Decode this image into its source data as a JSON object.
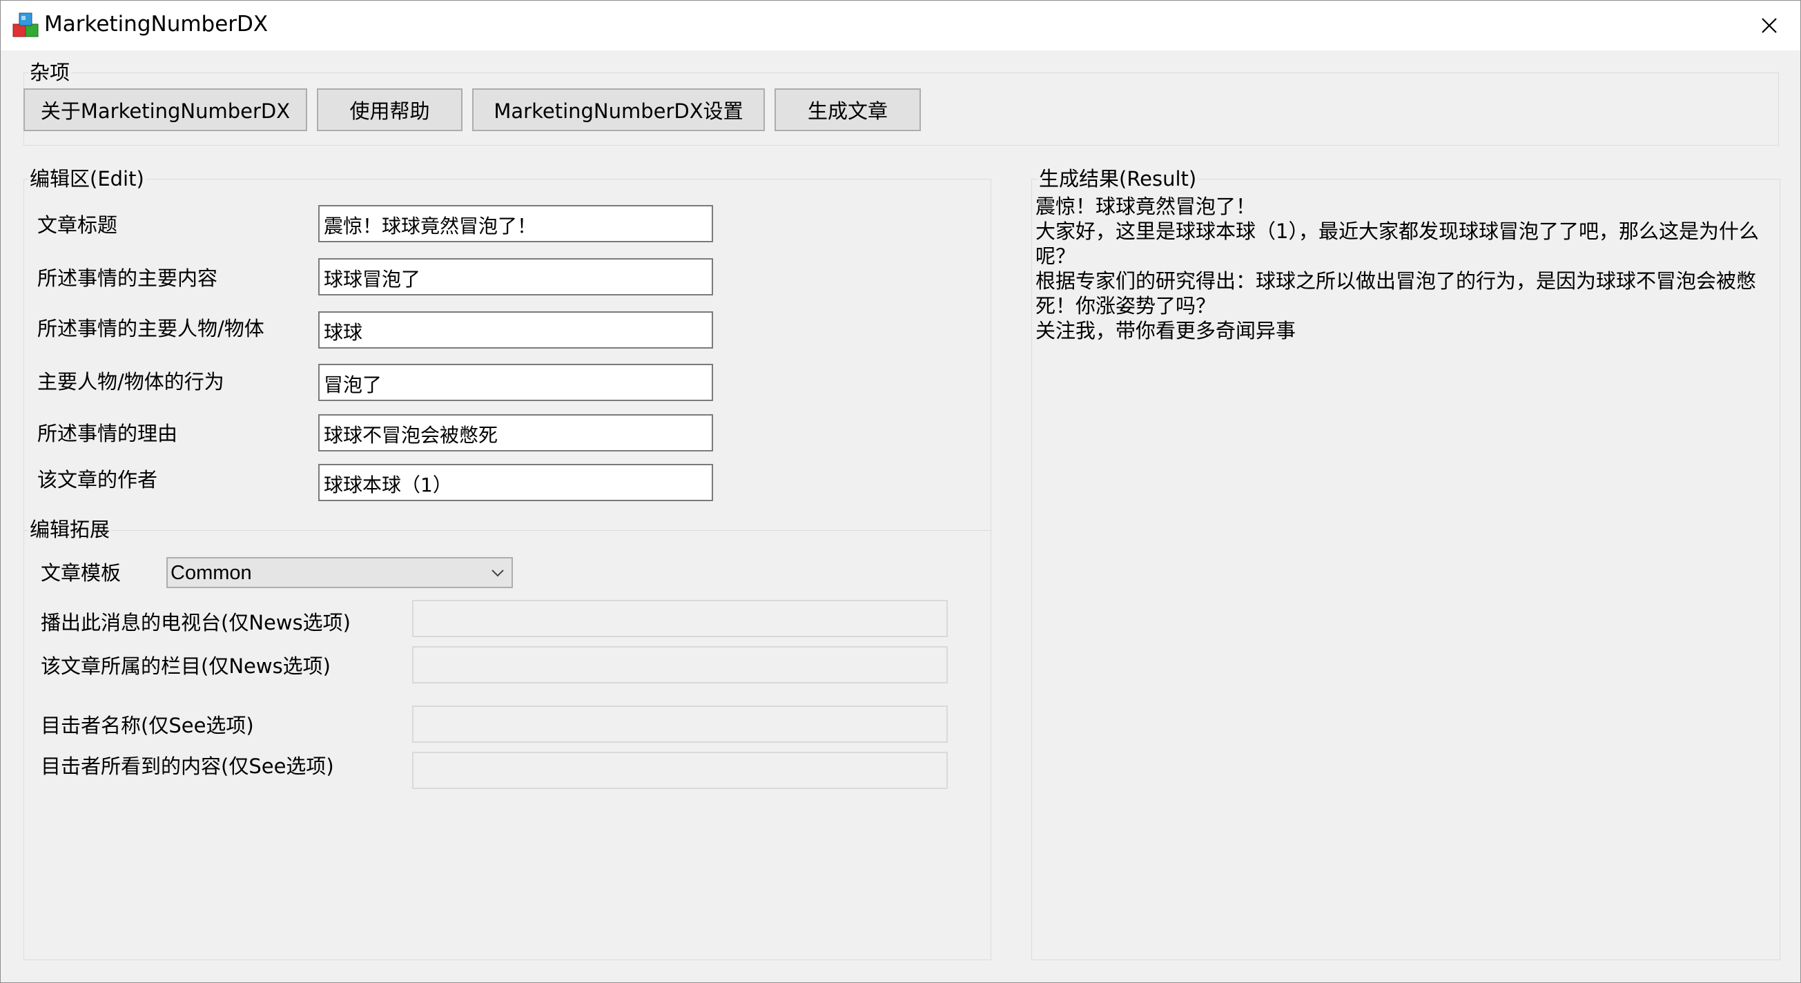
{
  "window": {
    "title": "MarketingNumberDX"
  },
  "misc_group": {
    "label": "杂项",
    "buttons": {
      "about": "关于MarketingNumberDX",
      "help": "使用帮助",
      "settings": "MarketingNumberDX设置",
      "generate": "生成文章"
    }
  },
  "edit_group": {
    "label": "编辑区(Edit)",
    "fields": {
      "title": {
        "label": "文章标题",
        "value": "震惊！球球竟然冒泡了！"
      },
      "content": {
        "label": "所述事情的主要内容",
        "value": "球球冒泡了"
      },
      "subject": {
        "label": "所述事情的主要人物/物体",
        "value": "球球"
      },
      "action": {
        "label": "主要人物/物体的行为",
        "value": "冒泡了"
      },
      "reason": {
        "label": "所述事情的理由",
        "value": "球球不冒泡会被憋死"
      },
      "author": {
        "label": "该文章的作者",
        "value": "球球本球（1）"
      }
    }
  },
  "extend_group": {
    "label": "编辑拓展",
    "template": {
      "label": "文章模板",
      "selected": "Common"
    },
    "tv_station": {
      "label": "播出此消息的电视台(仅News选项)",
      "value": ""
    },
    "column": {
      "label": "该文章所属的栏目(仅News选项)",
      "value": ""
    },
    "witness_name": {
      "label": "目击者名称(仅See选项)",
      "value": ""
    },
    "witness_content": {
      "label": "目击者所看到的内容(仅See选项)",
      "value": ""
    }
  },
  "result_group": {
    "label": "生成结果(Result)",
    "lines": [
      "震惊！球球竟然冒泡了！",
      "大家好，这里是球球本球（1），最近大家都发现球球冒泡了了吧，那么这是为什么呢？",
      "根据专家们的研究得出：球球之所以做出冒泡了的行为，是因为球球不冒泡会被憋死！你涨姿势了吗？",
      "关注我，带你看更多奇闻异事"
    ]
  },
  "icons": {
    "app": "app-cube-icon",
    "close": "close-icon",
    "dropdown": "chevron-down-icon"
  }
}
